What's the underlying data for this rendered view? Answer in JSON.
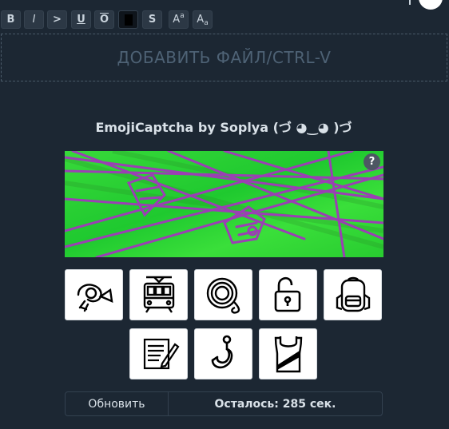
{
  "toolbar": {
    "buttons": [
      {
        "name": "bold-button",
        "label": "B"
      },
      {
        "name": "italic-button",
        "label": "I"
      },
      {
        "name": "quote-button",
        "label": ">"
      },
      {
        "name": "underline-button",
        "label": "U"
      },
      {
        "name": "overline-button",
        "label": "O"
      },
      {
        "name": "spoiler-button",
        "label": ""
      },
      {
        "name": "strike-button",
        "label": "S"
      },
      {
        "name": "superscript-button",
        "label": "A",
        "sub": "a"
      },
      {
        "name": "subscript-button",
        "label": "A",
        "sub": "a"
      }
    ]
  },
  "dropzone": {
    "label": "ДОБАВИТЬ ФАЙЛ/CTRL-V"
  },
  "captcha": {
    "title": "EmojiCaptcha by Soplya (づ ◕‿◕ )づ",
    "help_label": "?",
    "image_colors": {
      "background": "#2fd43a",
      "lines": "#9b3fb4"
    },
    "options": [
      {
        "name": "option-postal-horn",
        "icon": "postal-horn-icon"
      },
      {
        "name": "option-tram",
        "icon": "tram-icon"
      },
      {
        "name": "option-yoyo",
        "icon": "yoyo-icon"
      },
      {
        "name": "option-unlocked",
        "icon": "unlocked-padlock-icon"
      },
      {
        "name": "option-backpack",
        "icon": "backpack-icon"
      },
      {
        "name": "option-memo",
        "icon": "memo-icon"
      },
      {
        "name": "option-hook",
        "icon": "hook-icon"
      },
      {
        "name": "option-running-shirt",
        "icon": "running-shirt-icon"
      }
    ],
    "refresh_label": "Обновить",
    "timer_label": "Осталось: 285 сек."
  }
}
